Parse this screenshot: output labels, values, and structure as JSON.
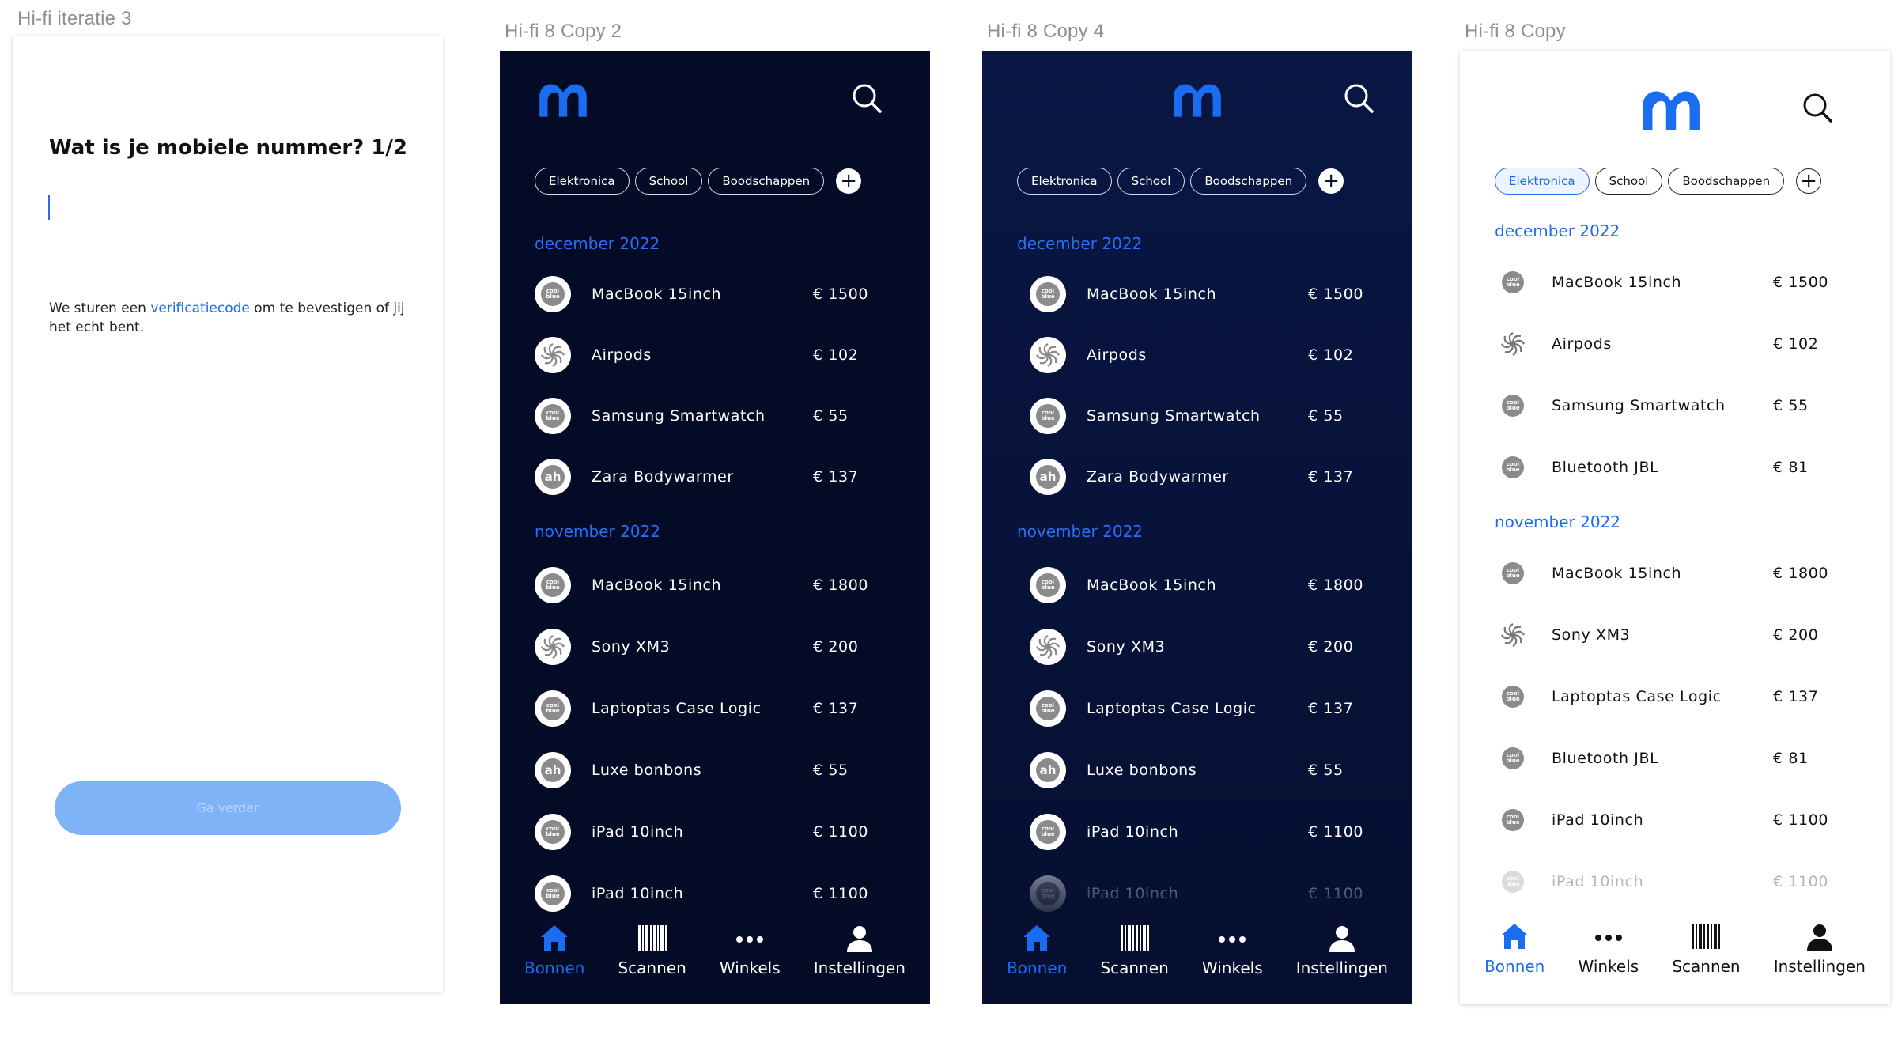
{
  "frames": [
    {
      "label": "Hi-fi iteratie 3"
    },
    {
      "label": "Hi-fi 8 Copy 2"
    },
    {
      "label": "Hi-fi 8 Copy 4"
    },
    {
      "label": "Hi-fi 8 Copy"
    }
  ],
  "verify": {
    "question": "Wat is je mobiele nummer? 1/2",
    "info_before": "We sturen een ",
    "info_link": "verificatiecode",
    "info_after": " om te bevestigen of jij het echt bent.",
    "button": "Ga verder"
  },
  "colors": {
    "accent": "#1a6cf0",
    "dark_bg": "#040b26",
    "dark_bg_alt": "#091744",
    "button_disabled": "#7fb3f7"
  },
  "chips": [
    "Elektronica",
    "School",
    "Boodschappen"
  ],
  "add_icon": "plus-icon",
  "months": {
    "december": "december 2022",
    "november": "november 2022"
  },
  "dark_list": {
    "december": [
      {
        "name": "MacBook 15inch",
        "price": "€ 1500",
        "store": "coolblue"
      },
      {
        "name": "Airpods",
        "price": "€ 102",
        "store": "mediamarkt"
      },
      {
        "name": "Samsung Smartwatch",
        "price": "€ 55",
        "store": "coolblue"
      },
      {
        "name": "Zara Bodywarmer",
        "price": "€ 137",
        "store": "albert-heijn"
      }
    ],
    "november": [
      {
        "name": "MacBook 15inch",
        "price": "€ 1800",
        "store": "coolblue"
      },
      {
        "name": "Sony XM3",
        "price": "€ 200",
        "store": "mediamarkt"
      },
      {
        "name": "Laptoptas Case Logic",
        "price": "€ 137",
        "store": "coolblue"
      },
      {
        "name": "Luxe bonbons",
        "price": "€ 55",
        "store": "albert-heijn"
      },
      {
        "name": "iPad 10inch",
        "price": "€ 1100",
        "store": "coolblue"
      },
      {
        "name": "iPad 10inch",
        "price": "€ 1100",
        "store": "coolblue"
      }
    ]
  },
  "light_list": {
    "december": [
      {
        "name": "MacBook 15inch",
        "price": "€ 1500",
        "store": "coolblue"
      },
      {
        "name": "Airpods",
        "price": "€ 102",
        "store": "mediamarkt"
      },
      {
        "name": "Samsung Smartwatch",
        "price": "€ 55",
        "store": "coolblue"
      },
      {
        "name": "Bluetooth JBL",
        "price": "€ 81",
        "store": "coolblue"
      }
    ],
    "november": [
      {
        "name": "MacBook 15inch",
        "price": "€ 1800",
        "store": "coolblue"
      },
      {
        "name": "Sony XM3",
        "price": "€ 200",
        "store": "mediamarkt"
      },
      {
        "name": "Laptoptas Case Logic",
        "price": "€ 137",
        "store": "coolblue"
      },
      {
        "name": "Bluetooth JBL",
        "price": "€ 81",
        "store": "coolblue"
      },
      {
        "name": "iPad 10inch",
        "price": "€ 1100",
        "store": "coolblue"
      },
      {
        "name": "iPad 10inch",
        "price": "€ 1100",
        "store": "coolblue"
      }
    ]
  },
  "nav_dark": [
    {
      "label": "Bonnen",
      "icon": "home-icon",
      "active": true
    },
    {
      "label": "Scannen",
      "icon": "barcode-icon",
      "active": false
    },
    {
      "label": "Winkels",
      "icon": "more-icon",
      "active": false
    },
    {
      "label": "Instellingen",
      "icon": "user-icon",
      "active": false
    }
  ],
  "nav_light": [
    {
      "label": "Bonnen",
      "icon": "home-icon",
      "active": true
    },
    {
      "label": "Winkels",
      "icon": "more-icon",
      "active": false
    },
    {
      "label": "Scannen",
      "icon": "barcode-icon",
      "active": false
    },
    {
      "label": "Instellingen",
      "icon": "user-icon",
      "active": false
    }
  ],
  "store_logo_text": {
    "coolblue": "cool blue"
  }
}
